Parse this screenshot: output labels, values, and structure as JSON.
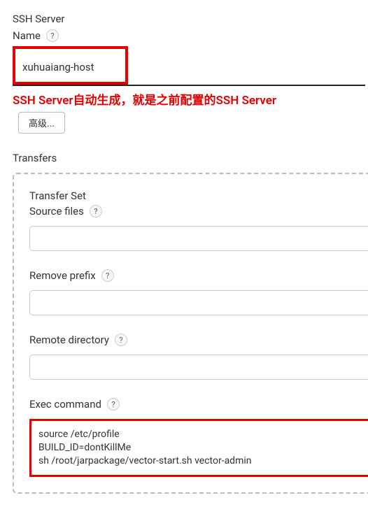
{
  "ssh_server": {
    "section_label": "SSH Server",
    "name_label": "Name",
    "name_value": "xuhuaiang-host"
  },
  "annotation": "SSH Server自动生成，就是之前配置的SSH Server",
  "advanced_button": "高级...",
  "transfers": {
    "section_label": "Transfers",
    "transfer_set_label": "Transfer Set",
    "source_files": {
      "label": "Source files",
      "value": ""
    },
    "remove_prefix": {
      "label": "Remove prefix",
      "value": ""
    },
    "remote_directory": {
      "label": "Remote directory",
      "value": ""
    },
    "exec_command": {
      "label": "Exec command",
      "value": "source /etc/profile\nBUILD_ID=dontKillMe\nsh /root/jarpackage/vector-start.sh vector-admin"
    }
  },
  "help_glyph": "?"
}
